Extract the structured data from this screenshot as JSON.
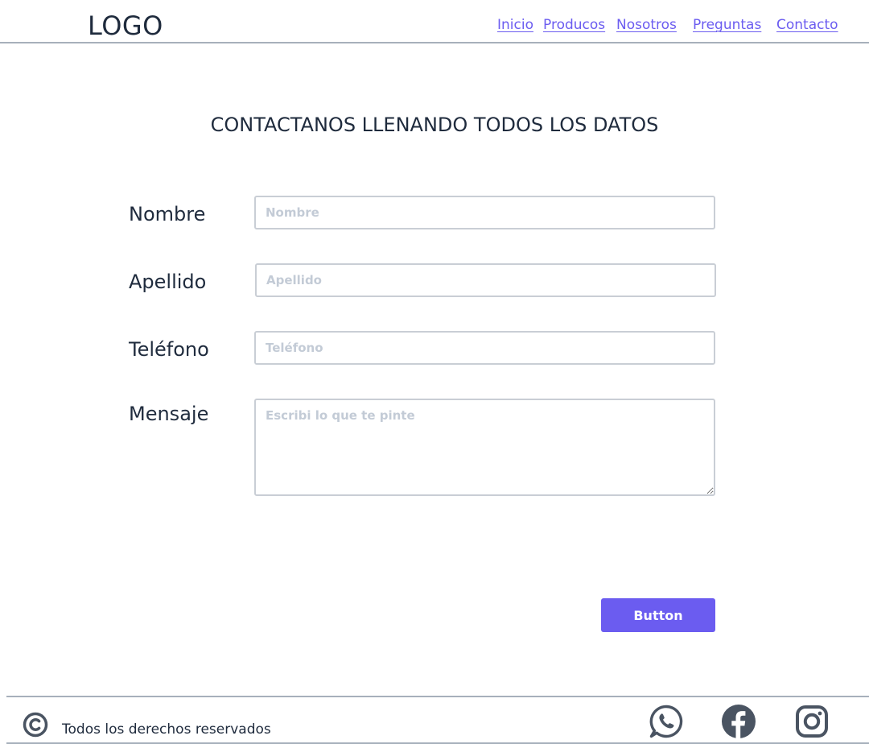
{
  "header": {
    "logo": "LOGO",
    "nav": [
      {
        "label": "Inicio"
      },
      {
        "label": "Producos"
      },
      {
        "label": "Nosotros"
      },
      {
        "label": "Preguntas"
      },
      {
        "label": "Contacto"
      }
    ]
  },
  "main": {
    "title": "CONTACTANOS LLENANDO TODOS LOS DATOS",
    "form": {
      "nombre": {
        "label": "Nombre",
        "placeholder": "Nombre",
        "value": ""
      },
      "apellido": {
        "label": "Apellido",
        "placeholder": "Apellido",
        "value": ""
      },
      "telefono": {
        "label": "Teléfono",
        "placeholder": "Teléfono",
        "value": ""
      },
      "mensaje": {
        "label": "Mensaje",
        "placeholder": "Escribi lo que te pinte",
        "value": ""
      },
      "submit_label": "Button"
    }
  },
  "footer": {
    "copyright_icon": "copyright-icon",
    "text": "Todos los derechos reservados",
    "social_icons": [
      "whatsapp-icon",
      "facebook-icon",
      "instagram-icon"
    ]
  },
  "colors": {
    "accent": "#6b5cf0",
    "text": "#1f2b3d",
    "border": "#c9ced5",
    "divider": "#a7b0bb",
    "placeholder": "#c3cbd6"
  }
}
